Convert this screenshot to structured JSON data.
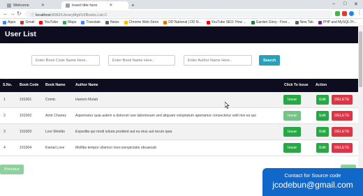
{
  "browser": {
    "tabs": [
      {
        "label": "Welcome"
      },
      {
        "label": "Insert title here"
      }
    ],
    "address": {
      "host": "localhost",
      "path": ":8082/LibraryMgt/UI/Books.List.C"
    },
    "bookmarks": [
      {
        "label": "Apps",
        "color": "#4285f4"
      },
      {
        "label": "Gmail",
        "color": "#d93025"
      },
      {
        "label": "YouTube",
        "color": "#ff0000"
      },
      {
        "label": "Maps",
        "color": "#34a853"
      },
      {
        "label": "Translate",
        "color": "#4285f4"
      },
      {
        "label": "News",
        "color": "#5f6368"
      },
      {
        "label": "Chrome Web Store",
        "color": "#fbbc04"
      },
      {
        "label": "DD National | DD N...",
        "color": "#e37400"
      },
      {
        "label": "YouTube SEO: How ...",
        "color": "#ff0000"
      },
      {
        "label": "Garden Glory - Free...",
        "color": "#188038"
      },
      {
        "label": "New Tab",
        "color": "#5f6368"
      },
      {
        "label": "PHP and MySQL Pr...",
        "color": "#7b1fa2"
      }
    ]
  },
  "page": {
    "title": "User List",
    "search": {
      "code_placeholder": "Enter Book Code Name Here..",
      "name_placeholder": "Enter Book Name Here..",
      "author_placeholder": "Enter Author Name Here..",
      "button_label": "Search"
    },
    "table": {
      "headers": {
        "sno": "S.No.",
        "code": "Book Code",
        "name": "Book Name",
        "author": "Author Name",
        "issue": "Click To Issue",
        "action": "Action"
      },
      "rows": [
        {
          "sno": "1",
          "code": "191001",
          "name": "Comic",
          "author": "Hariom Mulati"
        },
        {
          "sno": "2",
          "code": "191002",
          "name": "Amir Chaney",
          "author": "Aspernatur quia autem a dolorum iure laboriosam sed aliquam voluptatum aperiamur consectetur velit nisi ea qui"
        },
        {
          "sno": "3",
          "code": "191003",
          "name": "Levi Shields",
          "author": "Expedita qui modi soluta proident aut eu eius aut rerum quia"
        },
        {
          "sno": "4",
          "code": "191004",
          "name": "Kamal Love",
          "author": "Mollitia tempor ullamco irure perspiciatis obcaecati"
        }
      ],
      "issue_label": "Issue",
      "edit_label": "Edit",
      "delete_label": "DELETE"
    },
    "pagination": {
      "previous_label": "Previous"
    },
    "promo": {
      "line1": "Contact for Source code",
      "line2": "jcodebun@gmail.com"
    }
  },
  "colors": {
    "header_bg": "#0d0d1f",
    "search_btn": "#28a0b8",
    "issue_btn": "#28a745",
    "delete_btn": "#dc3545",
    "promo_bg": "#1268c8"
  }
}
